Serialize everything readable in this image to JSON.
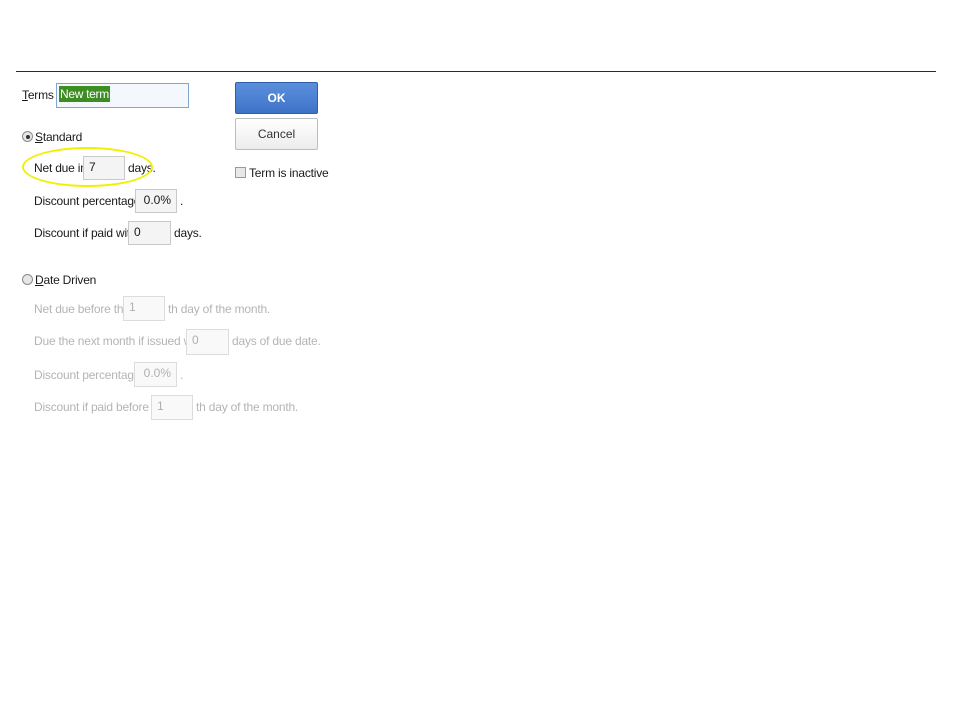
{
  "terms": {
    "label_first": "T",
    "label_rest": "erms",
    "value": "New term"
  },
  "buttons": {
    "ok": "OK",
    "cancel": "Cancel"
  },
  "inactive": {
    "label": "Term is inactive"
  },
  "standard": {
    "radio_first": "S",
    "radio_rest": "tandard",
    "net_due_label": "Net due in",
    "net_due_value": "7",
    "net_due_suffix": "days.",
    "discount_pct_label": "Discount percentage is",
    "discount_pct_value": "0.0%",
    "discount_pct_suffix": ".",
    "discount_within_label": "Discount if paid within",
    "discount_within_value": "0",
    "discount_within_suffix": "days."
  },
  "date_driven": {
    "radio_first": "D",
    "radio_rest": "ate Driven",
    "net_due_before_label": "Net due before the",
    "net_due_before_value": "1",
    "net_due_before_suffix": "th day of the month.",
    "next_month_label": "Due the next month if issued within",
    "next_month_value": "0",
    "next_month_suffix": "days of due date.",
    "discount_pct_label": "Discount percentage is",
    "discount_pct_value": "0.0%",
    "discount_pct_suffix": ".",
    "discount_before_label": "Discount if paid before the",
    "discount_before_value": "1",
    "discount_before_suffix": "th day of the month."
  },
  "colors": {
    "ok_button": "#4a7fd0",
    "selection_highlight": "#3c8d22",
    "annotation_circle": "#f0f000"
  }
}
